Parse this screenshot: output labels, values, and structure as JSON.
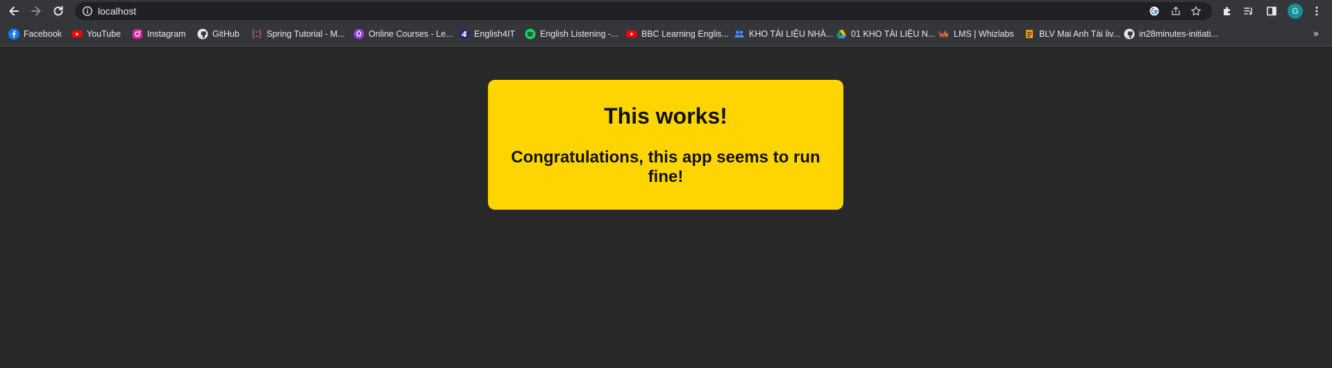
{
  "browser": {
    "url": "localhost",
    "avatar_letter": "G",
    "colors": {
      "toolbar": "#35363a",
      "omnibox": "#202124",
      "avatar": "#12939a"
    }
  },
  "bookmarks": {
    "items": [
      {
        "label": "Facebook",
        "icon": "facebook-icon"
      },
      {
        "label": "YouTube",
        "icon": "youtube-icon"
      },
      {
        "label": "Instagram",
        "icon": "instagram-icon"
      },
      {
        "label": "GitHub",
        "icon": "github-icon"
      },
      {
        "label": "Spring Tutorial - M...",
        "icon": "spring-icon"
      },
      {
        "label": "Online Courses - Le...",
        "icon": "courses-icon"
      },
      {
        "label": "English4IT",
        "icon": "english4it-icon"
      },
      {
        "label": "English Listening -...",
        "icon": "spotify-icon"
      },
      {
        "label": "BBC Learning Englis...",
        "icon": "youtube-icon"
      },
      {
        "label": "KHO TÀI LIỆU NHÀ...",
        "icon": "people-icon"
      },
      {
        "label": "01 KHO TÀI LIỆU N...",
        "icon": "google-drive-icon"
      },
      {
        "label": "LMS | Whizlabs",
        "icon": "whizlabs-icon"
      },
      {
        "label": "BLV Mai Anh Tài liv...",
        "icon": "blv-icon"
      },
      {
        "label": "in28minutes-initiati...",
        "icon": "github-icon"
      }
    ],
    "more": "»"
  },
  "page": {
    "title": "This works!",
    "message": "Congratulations, this app seems to run fine!",
    "colors": {
      "background": "#282828",
      "card": "#ffd500",
      "text": "#111111"
    }
  }
}
